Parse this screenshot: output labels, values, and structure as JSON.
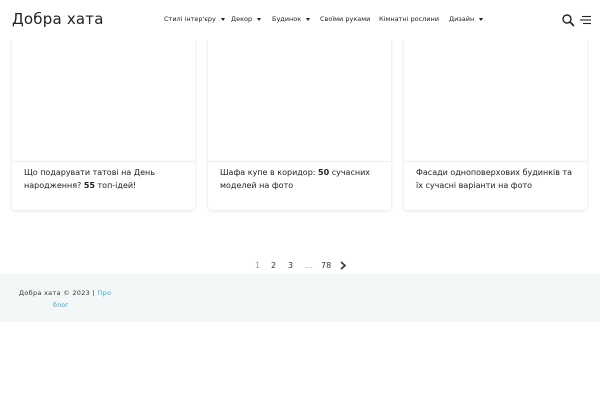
{
  "header": {
    "logo": "Добра хата",
    "nav": [
      {
        "label": "Стилі інтер'єру",
        "dropdown": true
      },
      {
        "label": "Декор",
        "dropdown": true
      },
      {
        "label": "Будинок",
        "dropdown": true
      },
      {
        "label": "Своїми руками",
        "dropdown": false
      },
      {
        "label": "Кімнатні рослини",
        "dropdown": false
      },
      {
        "label": "Дизайн",
        "dropdown": true
      }
    ],
    "icons": [
      "search-icon",
      "menu-icon"
    ]
  },
  "cards": [
    {
      "title_parts": [
        "Що подарувати татові на День народження? ",
        "55",
        " топ-ідей!"
      ]
    },
    {
      "title_parts": [
        "Шафа купе в коридор: ",
        "50",
        " сучасних моделей на фото"
      ]
    },
    {
      "title_parts": [
        "Фасади одноповерхових будинків та їх сучасні варіанти на фото",
        "",
        ""
      ]
    }
  ],
  "pagination": {
    "current": "1",
    "pages": [
      "2",
      "3"
    ],
    "dots": "…",
    "last": "78",
    "next_icon": "chevron-right-icon"
  },
  "footer": {
    "copyright": "Добра хата © 2023 | ",
    "about_link": "Про",
    "blog_link": "блог"
  },
  "colors": {
    "link": "#3fa9c9",
    "footer_bg": "#f4f7f8"
  }
}
